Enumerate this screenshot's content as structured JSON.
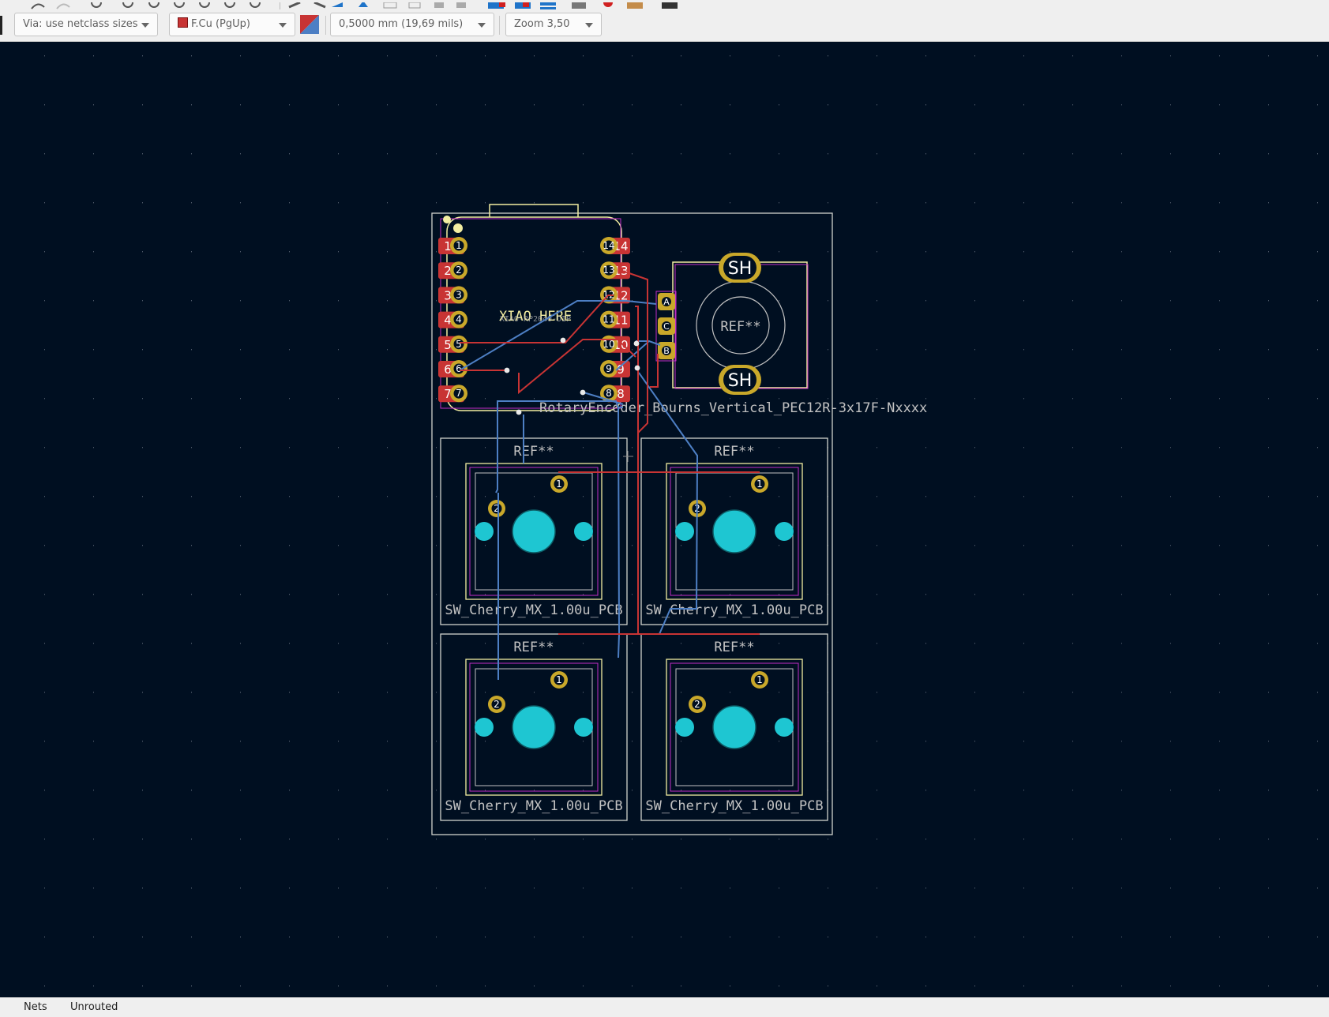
{
  "toolbar": {
    "via_size": "Via: use netclass sizes",
    "layer": "F.Cu (PgUp)",
    "track_width": "0,5000 mm (19,69 mils)",
    "zoom": "Zoom 3,50",
    "layer_color": "#c83434"
  },
  "board": {
    "mcu_label": "XIAO HERE",
    "mcu_label_small": "XIAO-RP2040-DIP",
    "encoder_ref": "REF**",
    "encoder_value": "RotaryEncoder_Bourns_Vertical_PEC12R-3x17F-Nxxxx",
    "encoder_shield_pads": [
      "SH",
      "SH"
    ],
    "encoder_pins": [
      "A",
      "C",
      "B"
    ],
    "xiao_left_pins": [
      "1",
      "2",
      "3",
      "4",
      "5",
      "6",
      "7"
    ],
    "xiao_right_pins": [
      "14",
      "13",
      "12",
      "11",
      "10",
      "9",
      "8"
    ],
    "switches": [
      {
        "ref": "REF**",
        "value": "SW_Cherry_MX_1.00u_PCB",
        "pads": [
          "1",
          "2"
        ]
      },
      {
        "ref": "REF**",
        "value": "SW_Cherry_MX_1.00u_PCB",
        "pads": [
          "1",
          "2"
        ]
      },
      {
        "ref": "REF**",
        "value": "SW_Cherry_MX_1.00u_PCB",
        "pads": [
          "1",
          "2"
        ]
      },
      {
        "ref": "REF**",
        "value": "SW_Cherry_MX_1.00u_PCB",
        "pads": [
          "1",
          "2"
        ]
      }
    ]
  },
  "colors": {
    "background": "#000f21",
    "edge_cuts": "#d0d2cd",
    "front_copper": "#c83434",
    "back_copper": "#4d7fc4",
    "pad_gold": "#c9a82a",
    "npth_cyan": "#1ec6d2",
    "silkscreen": "#f2eda1",
    "courtyard": "#c22cc7",
    "fab_text": "#c2c2c2"
  },
  "status": {
    "nets_label": "Nets",
    "unrouted_label": "Unrouted"
  }
}
